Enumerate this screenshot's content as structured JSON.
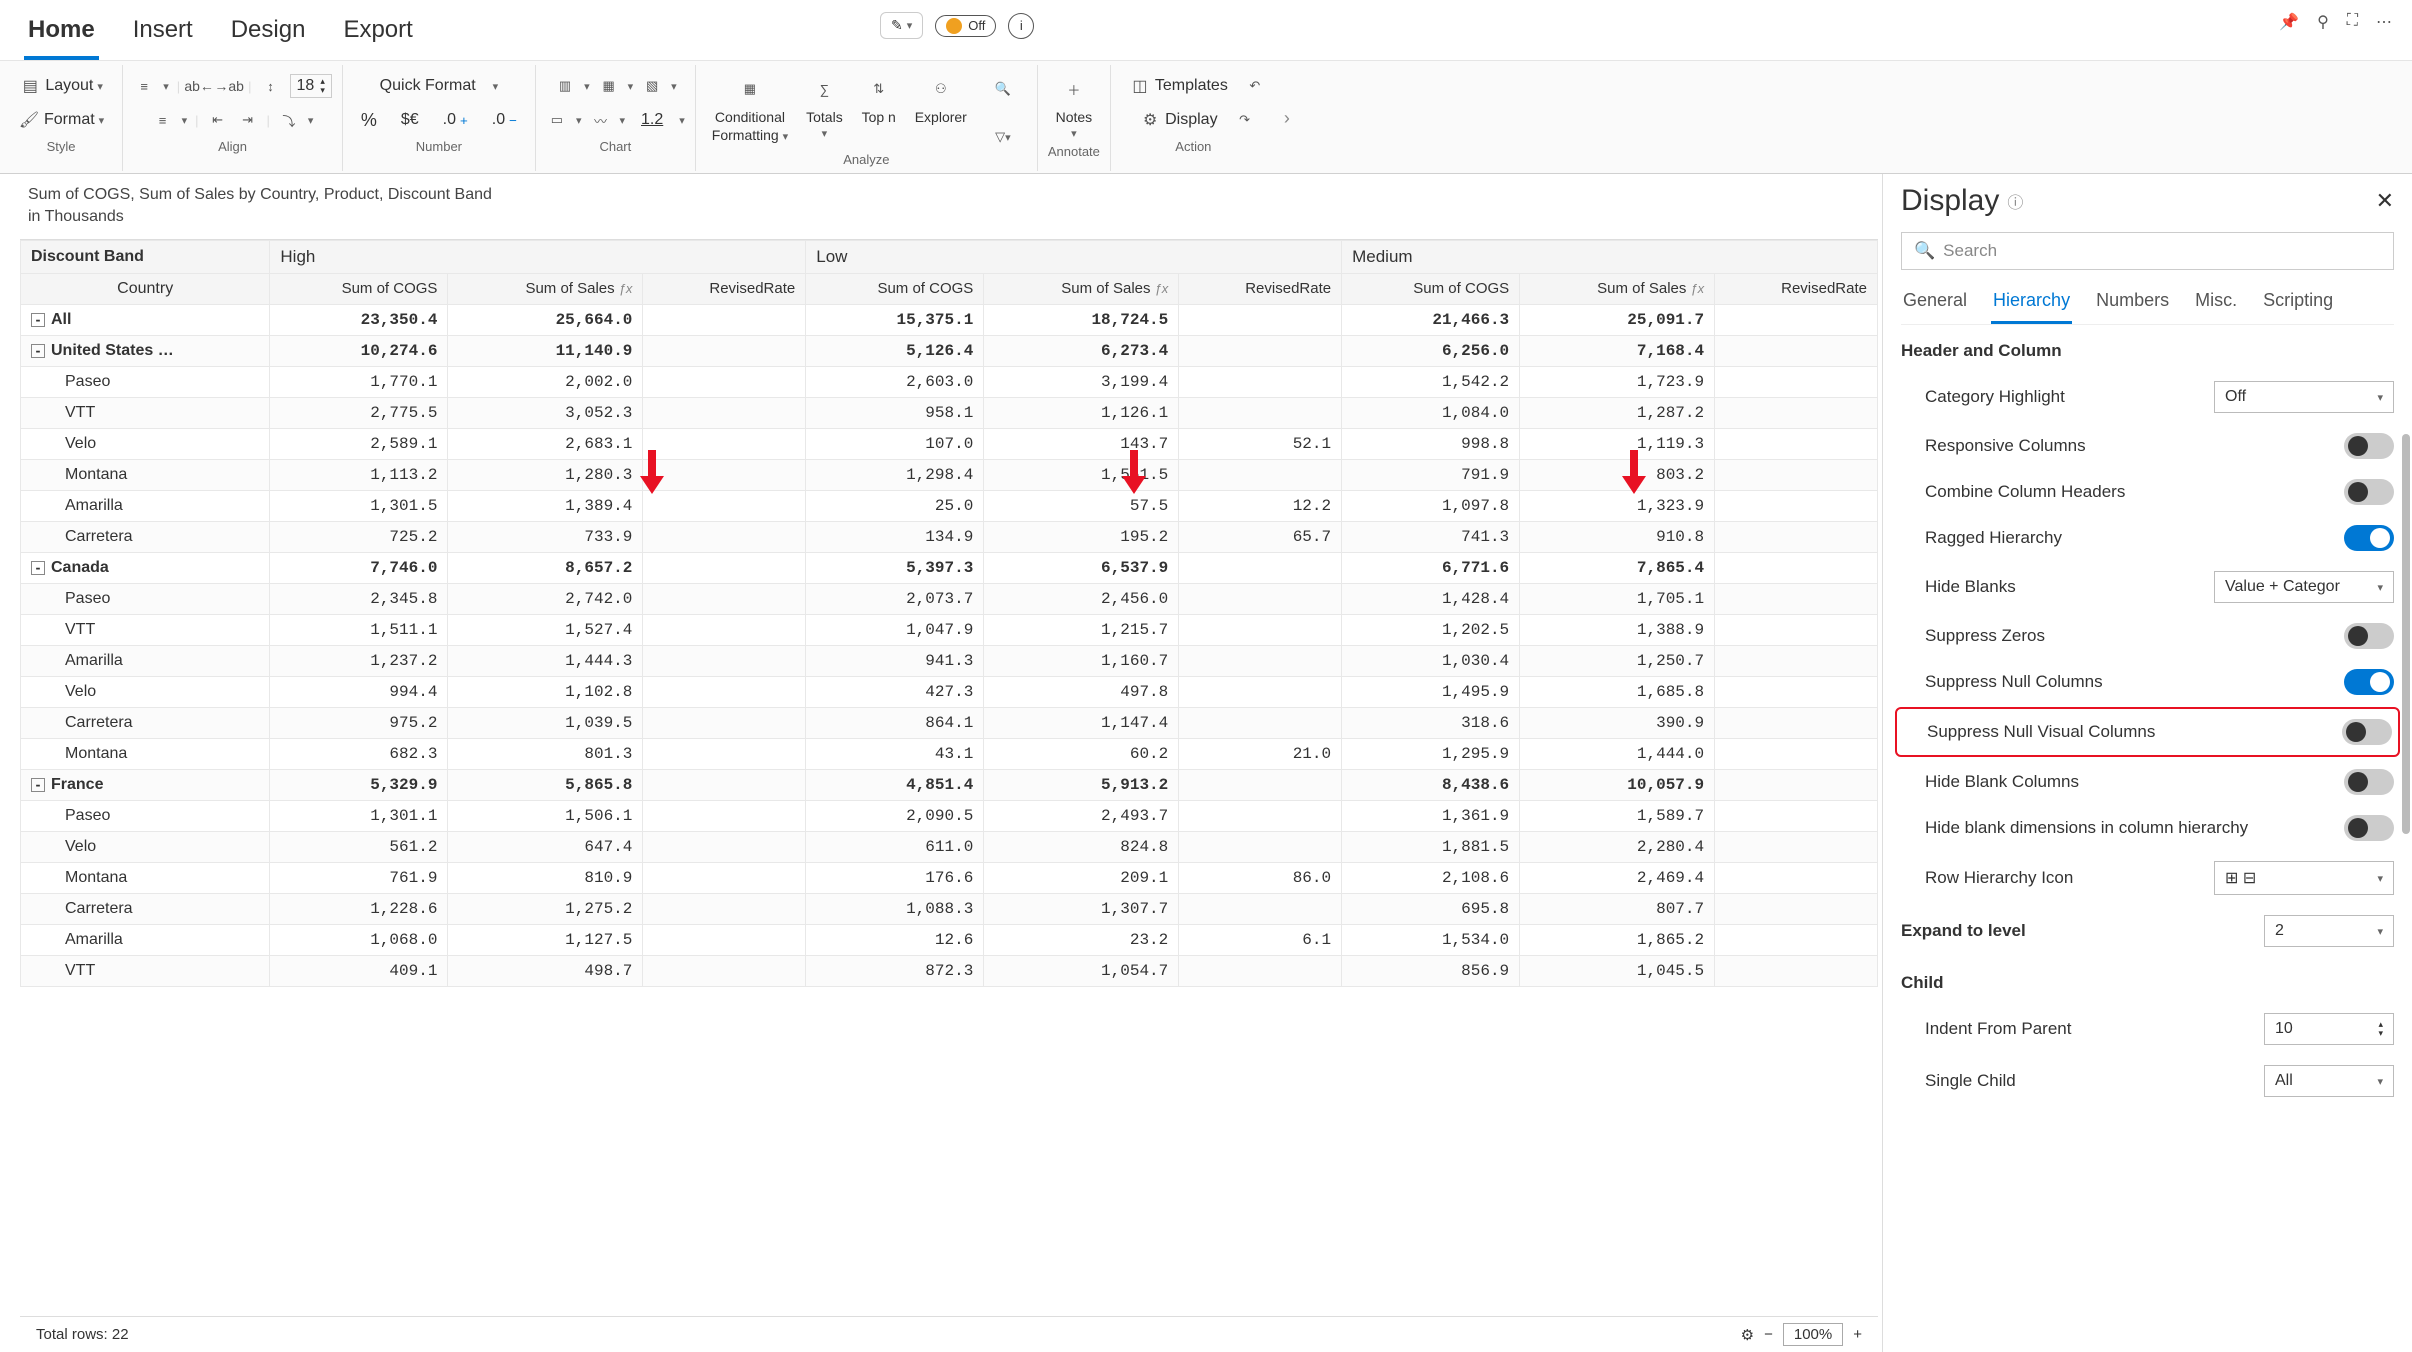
{
  "tabs": [
    "Home",
    "Insert",
    "Design",
    "Export"
  ],
  "active_tab": 0,
  "quickbar": {
    "off_label": "Off"
  },
  "ribbon": {
    "style": {
      "layout": "Layout",
      "format": "Format",
      "group": "Style"
    },
    "align": {
      "fontsize": "18",
      "group": "Align"
    },
    "number": {
      "quickformat": "Quick Format",
      "pct": "%",
      "currency": "$€",
      "d0p": ".0",
      "d0m": ".0",
      "group": "Number"
    },
    "chart": {
      "sparkline": "1.2",
      "group": "Chart"
    },
    "analyze": {
      "cond1": "Conditional",
      "cond2": "Formatting",
      "totals": "Totals",
      "topn": "Top n",
      "explorer": "Explorer",
      "group": "Analyze"
    },
    "annotate": {
      "notes": "Notes",
      "group": "Annotate"
    },
    "actions": {
      "templates": "Templates",
      "display": "Display",
      "group": "Action"
    }
  },
  "subtitle_line1": "Sum of COGS, Sum of  Sales by Country, Product, Discount Band",
  "subtitle_line2": "in Thousands",
  "headers": {
    "discount_band": "Discount Band",
    "country": "Country",
    "bands": [
      "High",
      "Low",
      "Medium"
    ],
    "cols": [
      "Sum of COGS",
      "Sum of Sales",
      "RevisedRate"
    ]
  },
  "rows": [
    {
      "label": "All",
      "bold": true,
      "exp": "-",
      "indent": 0,
      "v": [
        "23,350.4",
        "25,664.0",
        "",
        "15,375.1",
        "18,724.5",
        "",
        "21,466.3",
        "25,091.7",
        ""
      ]
    },
    {
      "label": "United States …",
      "bold": true,
      "exp": "-",
      "indent": 0,
      "v": [
        "10,274.6",
        "11,140.9",
        "",
        "5,126.4",
        "6,273.4",
        "",
        "6,256.0",
        "7,168.4",
        ""
      ]
    },
    {
      "label": "Paseo",
      "indent": 1,
      "v": [
        "1,770.1",
        "2,002.0",
        "",
        "2,603.0",
        "3,199.4",
        "",
        "1,542.2",
        "1,723.9",
        ""
      ]
    },
    {
      "label": "VTT",
      "indent": 1,
      "v": [
        "2,775.5",
        "3,052.3",
        "",
        "958.1",
        "1,126.1",
        "",
        "1,084.0",
        "1,287.2",
        ""
      ]
    },
    {
      "label": "Velo",
      "indent": 1,
      "v": [
        "2,589.1",
        "2,683.1",
        "",
        "107.0",
        "143.7",
        "52.1",
        "998.8",
        "1,119.3",
        ""
      ]
    },
    {
      "label": "Montana",
      "indent": 1,
      "v": [
        "1,113.2",
        "1,280.3",
        "",
        "1,298.4",
        "1,551.5",
        "",
        "791.9",
        "803.2",
        ""
      ]
    },
    {
      "label": "Amarilla",
      "indent": 1,
      "v": [
        "1,301.5",
        "1,389.4",
        "",
        "25.0",
        "57.5",
        "12.2",
        "1,097.8",
        "1,323.9",
        ""
      ]
    },
    {
      "label": "Carretera",
      "indent": 1,
      "v": [
        "725.2",
        "733.9",
        "",
        "134.9",
        "195.2",
        "65.7",
        "741.3",
        "910.8",
        ""
      ]
    },
    {
      "label": "Canada",
      "bold": true,
      "exp": "-",
      "indent": 0,
      "v": [
        "7,746.0",
        "8,657.2",
        "",
        "5,397.3",
        "6,537.9",
        "",
        "6,771.6",
        "7,865.4",
        ""
      ]
    },
    {
      "label": "Paseo",
      "indent": 1,
      "v": [
        "2,345.8",
        "2,742.0",
        "",
        "2,073.7",
        "2,456.0",
        "",
        "1,428.4",
        "1,705.1",
        ""
      ]
    },
    {
      "label": "VTT",
      "indent": 1,
      "v": [
        "1,511.1",
        "1,527.4",
        "",
        "1,047.9",
        "1,215.7",
        "",
        "1,202.5",
        "1,388.9",
        ""
      ]
    },
    {
      "label": "Amarilla",
      "indent": 1,
      "v": [
        "1,237.2",
        "1,444.3",
        "",
        "941.3",
        "1,160.7",
        "",
        "1,030.4",
        "1,250.7",
        ""
      ]
    },
    {
      "label": "Velo",
      "indent": 1,
      "v": [
        "994.4",
        "1,102.8",
        "",
        "427.3",
        "497.8",
        "",
        "1,495.9",
        "1,685.8",
        ""
      ]
    },
    {
      "label": "Carretera",
      "indent": 1,
      "v": [
        "975.2",
        "1,039.5",
        "",
        "864.1",
        "1,147.4",
        "",
        "318.6",
        "390.9",
        ""
      ]
    },
    {
      "label": "Montana",
      "indent": 1,
      "v": [
        "682.3",
        "801.3",
        "",
        "43.1",
        "60.2",
        "21.0",
        "1,295.9",
        "1,444.0",
        ""
      ]
    },
    {
      "label": "France",
      "bold": true,
      "exp": "-",
      "indent": 0,
      "v": [
        "5,329.9",
        "5,865.8",
        "",
        "4,851.4",
        "5,913.2",
        "",
        "8,438.6",
        "10,057.9",
        ""
      ]
    },
    {
      "label": "Paseo",
      "indent": 1,
      "v": [
        "1,301.1",
        "1,506.1",
        "",
        "2,090.5",
        "2,493.7",
        "",
        "1,361.9",
        "1,589.7",
        ""
      ]
    },
    {
      "label": "Velo",
      "indent": 1,
      "v": [
        "561.2",
        "647.4",
        "",
        "611.0",
        "824.8",
        "",
        "1,881.5",
        "2,280.4",
        ""
      ]
    },
    {
      "label": "Montana",
      "indent": 1,
      "v": [
        "761.9",
        "810.9",
        "",
        "176.6",
        "209.1",
        "86.0",
        "2,108.6",
        "2,469.4",
        ""
      ]
    },
    {
      "label": "Carretera",
      "indent": 1,
      "v": [
        "1,228.6",
        "1,275.2",
        "",
        "1,088.3",
        "1,307.7",
        "",
        "695.8",
        "807.7",
        ""
      ]
    },
    {
      "label": "Amarilla",
      "indent": 1,
      "v": [
        "1,068.0",
        "1,127.5",
        "",
        "12.6",
        "23.2",
        "6.1",
        "1,534.0",
        "1,865.2",
        ""
      ]
    },
    {
      "label": "VTT",
      "indent": 1,
      "v": [
        "409.1",
        "498.7",
        "",
        "872.3",
        "1,054.7",
        "",
        "856.9",
        "1,045.5",
        ""
      ]
    }
  ],
  "status": {
    "total_rows": "Total rows: 22",
    "zoom": "100%"
  },
  "panel": {
    "title": "Display",
    "search_placeholder": "Search",
    "tabs": [
      "General",
      "Hierarchy",
      "Numbers",
      "Misc.",
      "Scripting"
    ],
    "active_tab": 1,
    "section1": "Header and Column",
    "category_highlight": {
      "label": "Category Highlight",
      "value": "Off"
    },
    "responsive_columns": "Responsive Columns",
    "combine_headers": "Combine Column Headers",
    "ragged": "Ragged Hierarchy",
    "hide_blanks": {
      "label": "Hide Blanks",
      "value": "Value + Categor"
    },
    "suppress_zeros": "Suppress Zeros",
    "suppress_null_cols": "Suppress Null Columns",
    "suppress_null_visual": "Suppress Null Visual Columns",
    "hide_blank_cols": "Hide Blank Columns",
    "hide_blank_dims": "Hide blank dimensions in column hierarchy",
    "row_hierarchy_icon": "Row Hierarchy Icon",
    "expand_to_level": {
      "label": "Expand to level",
      "value": "2"
    },
    "section_child": "Child",
    "indent_parent": {
      "label": "Indent From Parent",
      "value": "10"
    },
    "single_child": {
      "label": "Single Child",
      "value": "All"
    },
    "row_icons": "⊞ ⊟"
  }
}
